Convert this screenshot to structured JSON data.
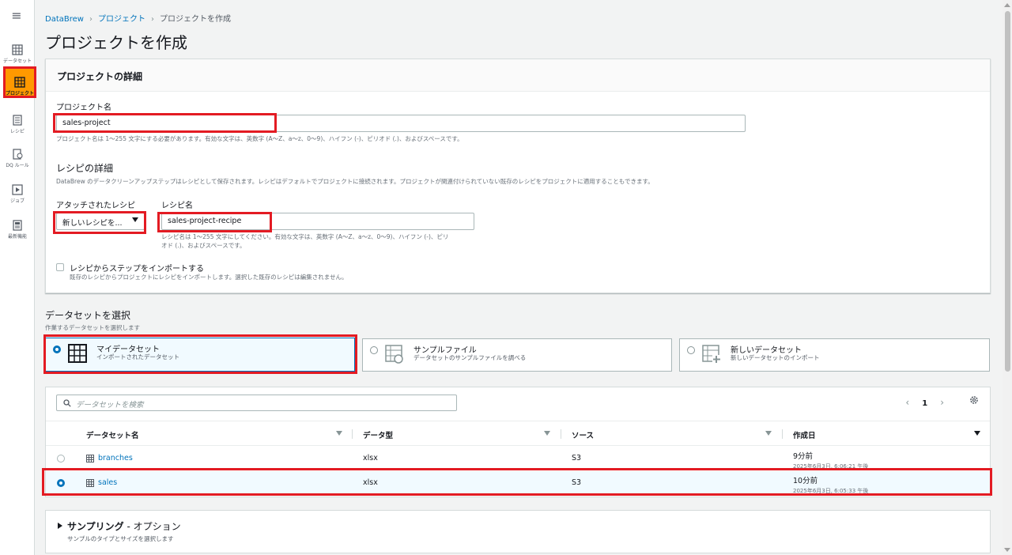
{
  "breadcrumb": {
    "items": [
      "DataBrew",
      "プロジェクト",
      "プロジェクトを作成"
    ]
  },
  "page_title": "プロジェクトを作成",
  "nav": {
    "items": [
      {
        "label": "データセット",
        "icon": "table-icon"
      },
      {
        "label": "プロジェクト",
        "icon": "project-icon"
      },
      {
        "label": "レシピ",
        "icon": "recipe-icon"
      },
      {
        "label": "DQ ルール",
        "icon": "dq-rules-icon"
      },
      {
        "label": "ジョブ",
        "icon": "jobs-icon"
      },
      {
        "label": "最新機能",
        "icon": "news-icon"
      }
    ],
    "active": "プロジェクト"
  },
  "details": {
    "header": "プロジェクトの詳細",
    "name_label": "プロジェクト名",
    "name_value": "sales-project",
    "name_hint": "プロジェクト名は 1〜255 文字にする必要があります。有効な文字は、英数字 (A〜Z、a〜z、0〜9)、ハイフン (-)、ピリオド (.)、およびスペースです。",
    "recipe_title": "レシピの詳細",
    "recipe_desc": "DataBrew のデータクリーンアップステップはレシピとして保存されます。レシピはデフォルトでプロジェクトに接続されます。プロジェクトが関連付けられていない既存のレシピをプロジェクトに適用することもできます。",
    "attached_label": "アタッチされたレシピ",
    "attached_value": "新しいレシピを...",
    "recipe_name_label": "レシピ名",
    "recipe_name_value": "sales-project-recipe",
    "recipe_name_hint1": "レシピ名は 1〜255 文字にしてください。有効な文字は、英数字 (A〜Z、a〜z、0〜9)、ハイフン (-)、ピリ",
    "recipe_name_hint2": "オド (.)、およびスペースです。",
    "import_label": "レシピからステップをインポートする",
    "import_desc": "既存のレシピからプロジェクトにレシピをインポートします。選択した既存のレシピは編集されません。"
  },
  "dataset": {
    "title": "データセットを選択",
    "subtitle": "作業するデータセットを選択します",
    "options": [
      {
        "title": "マイデータセット",
        "sub": "インポートされたデータセット",
        "selected": true
      },
      {
        "title": "サンプルファイル",
        "sub": "データセットのサンプルファイルを調べる",
        "selected": false
      },
      {
        "title": "新しいデータセット",
        "sub": "新しいデータセットのインポート",
        "selected": false
      }
    ],
    "search_placeholder": "データセットを検索",
    "page": "1",
    "columns": [
      "データセット名",
      "データ型",
      "ソース",
      "作成日"
    ],
    "rows": [
      {
        "name": "branches",
        "type": "xlsx",
        "source": "S3",
        "created": "9分前",
        "created_full": "2025年6月3日, 6:06:21 午後",
        "selected": false
      },
      {
        "name": "sales",
        "type": "xlsx",
        "source": "S3",
        "created": "10分前",
        "created_full": "2025年6月3日, 6:05:33 午後",
        "selected": true
      }
    ]
  },
  "sampling": {
    "title": "サンプリング",
    "optional": " - オプション",
    "sub": "サンプルのタイプとサイズを選択します"
  }
}
